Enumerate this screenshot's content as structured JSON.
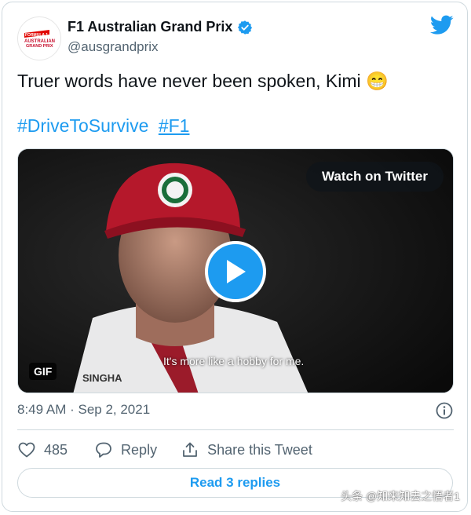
{
  "author": {
    "name": "F1 Australian Grand Prix",
    "handle": "@ausgrandprix",
    "avatar_logo_text": [
      "FORMULA 1",
      "AUSTRALIAN",
      "GRAND PRIX"
    ]
  },
  "tweet": {
    "text": "Truer words have never been spoken, Kimi",
    "emoji": "😁",
    "hashtags": [
      "#DriveToSurvive",
      "#F1"
    ]
  },
  "media": {
    "watch_label": "Watch on Twitter",
    "gif_label": "GIF",
    "subtitle": "It's more like a hobby for me.",
    "jersey_text": "SINGHA"
  },
  "meta": {
    "timestamp": "8:49 AM · Sep 2, 2021"
  },
  "actions": {
    "like_count": "485",
    "reply_label": "Reply",
    "share_label": "Share this Tweet"
  },
  "read_replies_label": "Read 3 replies",
  "watermark": "头条 @知来知去之悟者1",
  "colors": {
    "accent": "#1d9bf0",
    "secondary_text": "#536471",
    "border": "#cfd9de"
  }
}
